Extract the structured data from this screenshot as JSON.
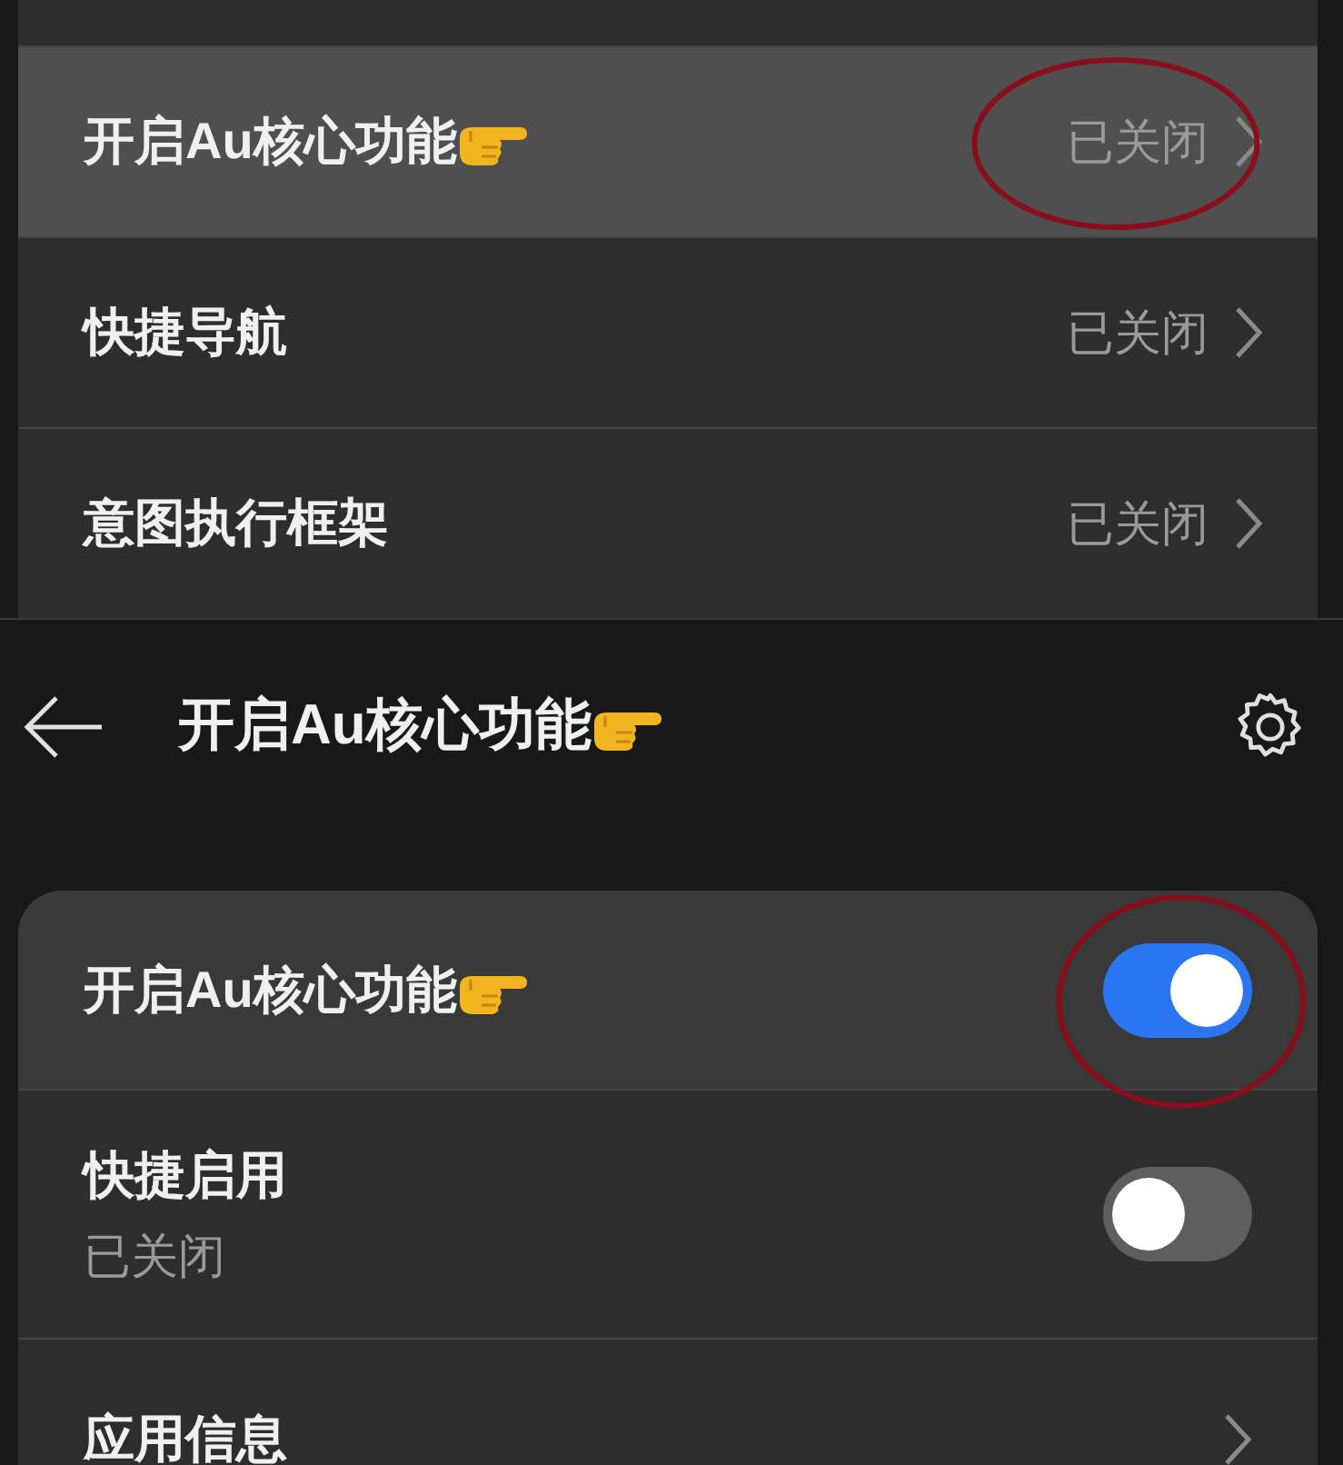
{
  "menu_items": [
    {
      "label": "开启Au核心功能",
      "pointer": true,
      "status": "已关闭",
      "selected": true
    },
    {
      "label": "快捷导航",
      "pointer": false,
      "status": "已关闭",
      "selected": false
    },
    {
      "label": "意图执行框架",
      "pointer": false,
      "status": "已关闭",
      "selected": false
    }
  ],
  "header": {
    "title": "开启Au核心功能",
    "pointer": true
  },
  "settings": [
    {
      "kind": "switch",
      "label": "开启Au核心功能",
      "pointer": true,
      "on": true
    },
    {
      "kind": "switch",
      "label": "快捷启用",
      "pointer": false,
      "subtitle": "已关闭",
      "on": false
    },
    {
      "kind": "link",
      "label": "应用信息",
      "pointer": false
    }
  ]
}
